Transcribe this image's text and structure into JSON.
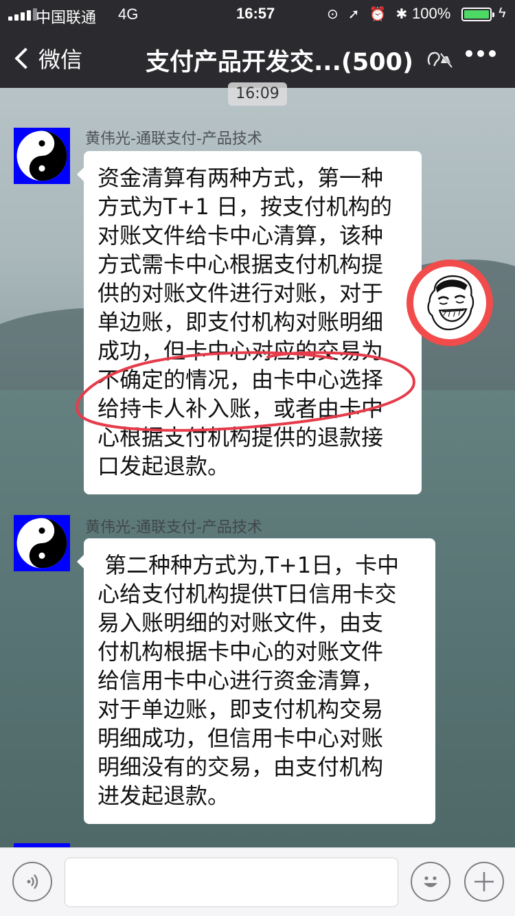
{
  "status_bar": {
    "carrier": "中国联通",
    "network": "4G",
    "time": "16:57",
    "battery": "100%"
  },
  "nav": {
    "back_label": "微信",
    "title": "支付产品开发交...(500)"
  },
  "chat": {
    "timestamp": "16:09",
    "messages": [
      {
        "sender": "黄伟光-通联支付-产品技术",
        "lines": [
          "资金清算有两种方式，第一种",
          "方式为T+1 日，按支付机构的",
          "对账文件给卡中心清算，该种",
          "方式需卡中心根据支付机构提",
          "供的对账文件进行对账，对于",
          "单边账，即支付机构对账明细",
          "成功，但卡中心对应的交易为",
          "不确定的情况，由卡中心选择",
          "给持卡人补入账，或者由卡中",
          "心根据支付机构提供的退款接",
          "口发起退款。"
        ]
      },
      {
        "sender": "黄伟光-通联支付-产品技术",
        "lines": [
          " 第二种种方式为,T+1日，卡中",
          "心给支付机构提供T日信用卡交",
          "易入账明细的对账文件，由支",
          "付机构根据卡中心的对账文件",
          "给信用卡中心进行资金清算，",
          "对于单边账，即支付机构交易",
          "明细成功，但信用卡中心对账",
          "明细没有的交易，由支付机构",
          "进发起退款。"
        ]
      }
    ]
  },
  "input_bar": {
    "voice_icon": "voice-icon",
    "emoji_icon": "emoji-icon",
    "plus_icon": "plus-icon",
    "text_value": ""
  },
  "colors": {
    "nav_bg": "#2b2b2f",
    "avatar_bg": "#0000ff",
    "annotation": "#e63b4a",
    "battery": "#4cd964"
  }
}
